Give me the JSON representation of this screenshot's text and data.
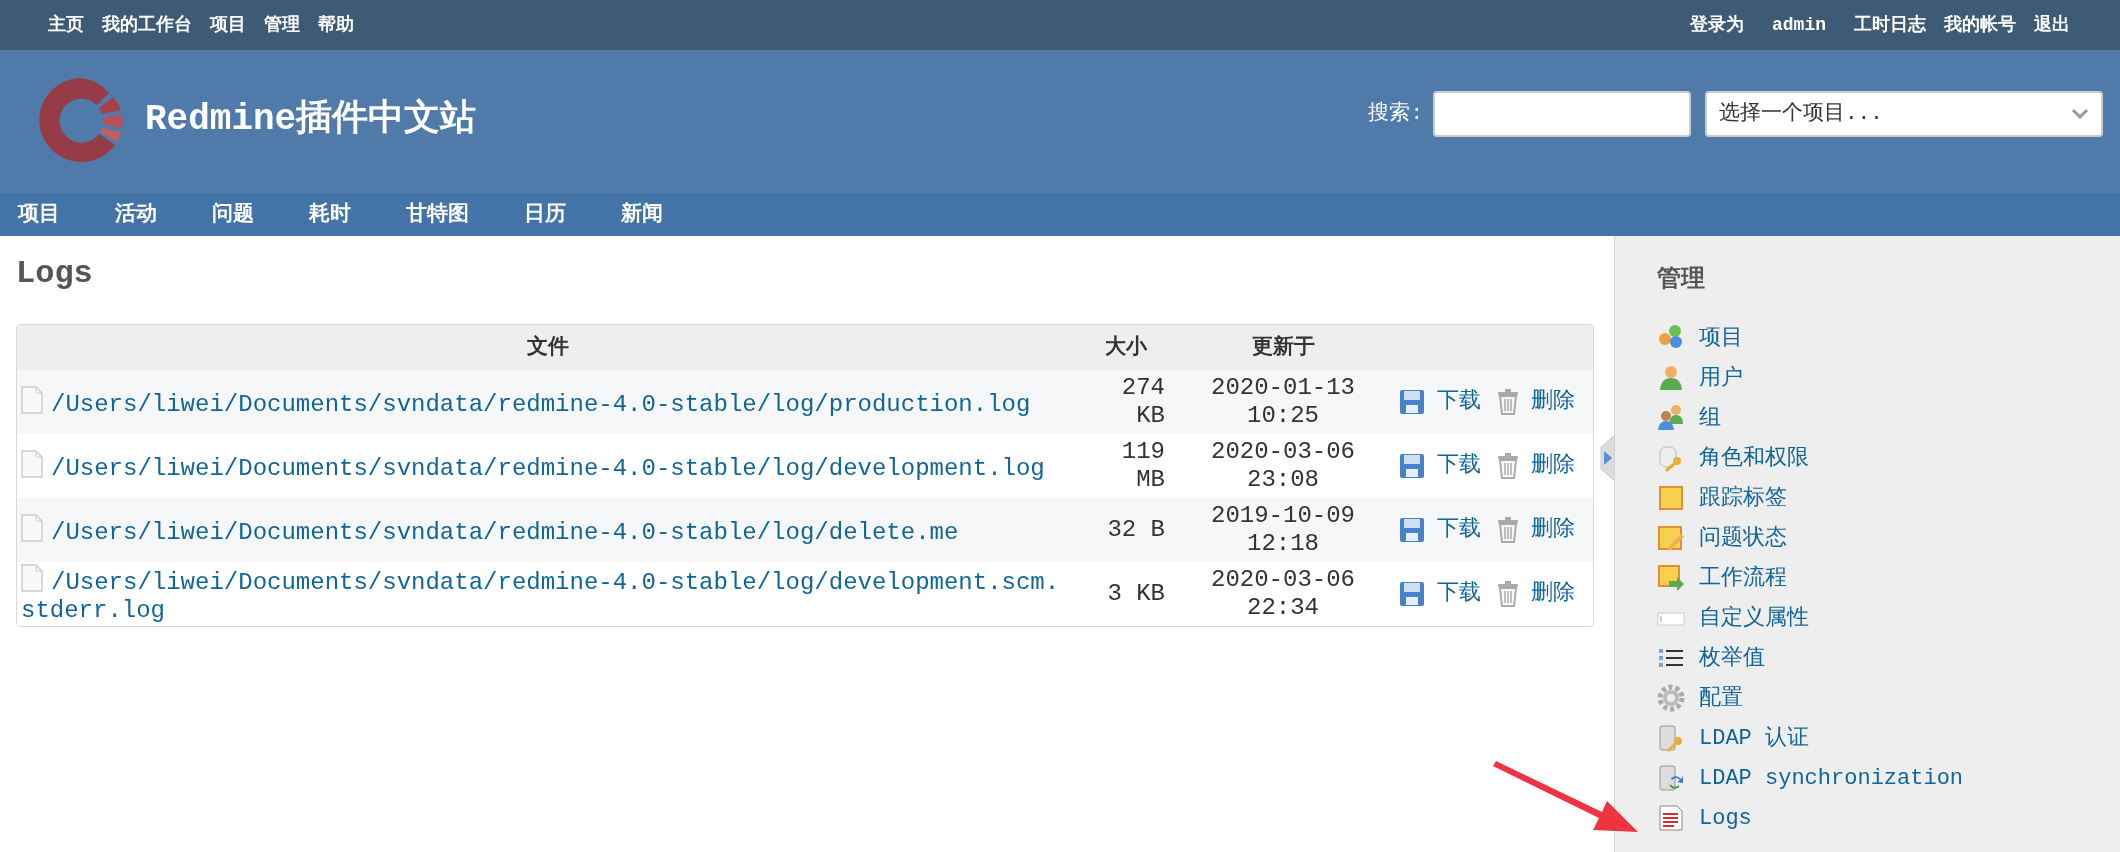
{
  "top_menu": {
    "left": [
      "主页",
      "我的工作台",
      "项目",
      "管理",
      "帮助"
    ],
    "logged_in_label": "登录为",
    "user": "admin",
    "right": [
      "工时日志",
      "我的帐号",
      "退出"
    ]
  },
  "header": {
    "title": "Redmine插件中文站",
    "search_label": "搜索:",
    "project_select": {
      "placeholder": "选择一个项目..."
    }
  },
  "main_menu": [
    "项目",
    "活动",
    "问题",
    "耗时",
    "甘特图",
    "日历",
    "新闻"
  ],
  "page_title": "Logs",
  "table": {
    "columns": [
      "文件",
      "大小",
      "更新于"
    ],
    "rows": [
      {
        "file": "/Users/liwei/Documents/svndata/redmine-4.0-stable/log/production.log",
        "size": "274 KB",
        "updated": "2020-01-13 10:25",
        "download": "下载",
        "delete": "删除"
      },
      {
        "file": "/Users/liwei/Documents/svndata/redmine-4.0-stable/log/development.log",
        "size": "119 MB",
        "updated": "2020-03-06 23:08",
        "download": "下载",
        "delete": "删除"
      },
      {
        "file": "/Users/liwei/Documents/svndata/redmine-4.0-stable/log/delete.me",
        "size": "32 B",
        "updated": "2019-10-09 12:18",
        "download": "下载",
        "delete": "删除"
      },
      {
        "file": "/Users/liwei/Documents/svndata/redmine-4.0-stable/log/development.scm.stderr.log",
        "size": "3 KB",
        "updated": "2020-03-06 22:34",
        "download": "下载",
        "delete": "删除"
      }
    ]
  },
  "sidebar": {
    "title": "管理",
    "items": [
      {
        "kind": "projects",
        "label": "项目"
      },
      {
        "kind": "users",
        "label": "用户"
      },
      {
        "kind": "groups",
        "label": "组"
      },
      {
        "kind": "roles",
        "label": "角色和权限"
      },
      {
        "kind": "trackers",
        "label": "跟踪标签"
      },
      {
        "kind": "statuses",
        "label": "问题状态"
      },
      {
        "kind": "workflows",
        "label": "工作流程"
      },
      {
        "kind": "custom_fields",
        "label": "自定义属性"
      },
      {
        "kind": "enumerations",
        "label": "枚举值"
      },
      {
        "kind": "settings",
        "label": "配置"
      },
      {
        "kind": "ldap",
        "label": "LDAP 认证"
      },
      {
        "kind": "ldap_sync",
        "label": "LDAP synchronization"
      },
      {
        "kind": "logs",
        "label": "Logs"
      }
    ]
  }
}
